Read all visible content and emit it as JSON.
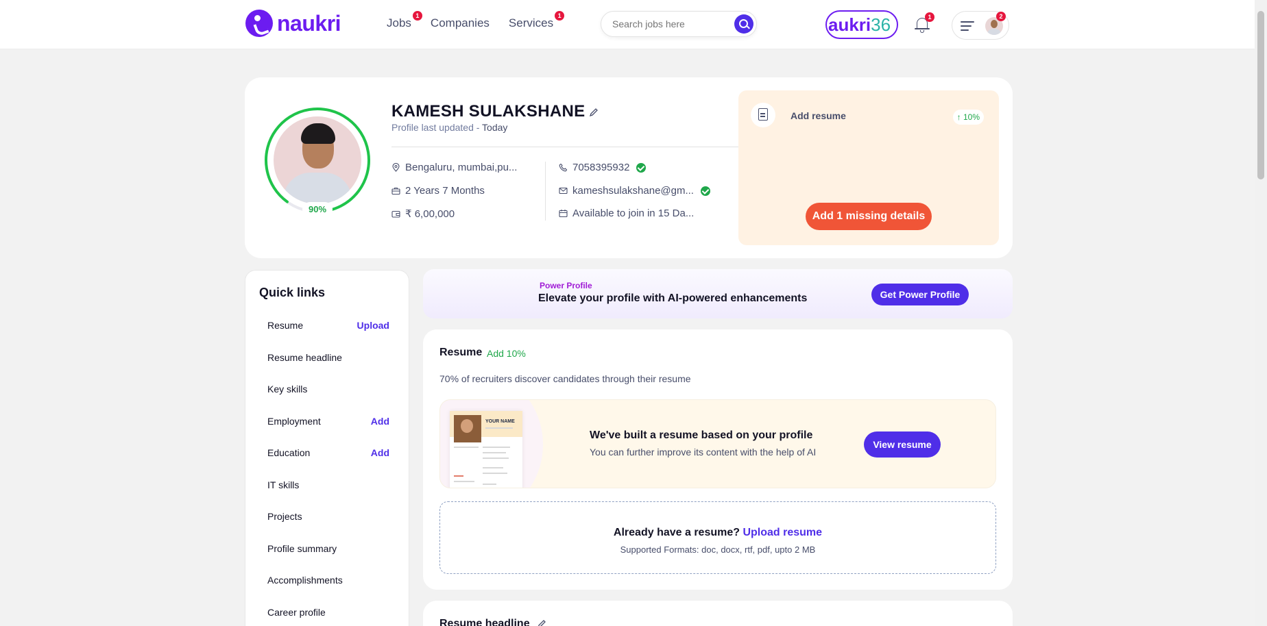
{
  "header": {
    "logo_text": "naukri",
    "nav": [
      {
        "label": "Jobs",
        "badge": "1"
      },
      {
        "label": "Companies",
        "badge": ""
      },
      {
        "label": "Services",
        "badge": "1"
      }
    ],
    "search_placeholder": "Search jobs here",
    "naukri360": {
      "left": "aukri",
      "right": "36"
    },
    "bell_badge": "1",
    "menu_badge": "2"
  },
  "profile": {
    "name": "KAMESH SULAKSHANE",
    "updated_label": "Profile last updated - ",
    "updated_value": "Today",
    "completion": "90%",
    "completion_value": 0.9,
    "location": "Bengaluru, mumbai,pu...",
    "experience": "2 Years 7 Months",
    "salary": "₹ 6,00,000",
    "phone": "7058395932",
    "email": "kameshsulakshane@gm...",
    "notice": "Available to join in 15 Da..."
  },
  "missing": {
    "item_label": "Add resume",
    "item_pct": "↑ 10%",
    "button": "Add 1 missing details"
  },
  "quick_links": {
    "title": "Quick links",
    "items": [
      {
        "label": "Resume",
        "action": "Upload"
      },
      {
        "label": "Resume headline",
        "action": ""
      },
      {
        "label": "Key skills",
        "action": ""
      },
      {
        "label": "Employment",
        "action": "Add"
      },
      {
        "label": "Education",
        "action": "Add"
      },
      {
        "label": "IT skills",
        "action": ""
      },
      {
        "label": "Projects",
        "action": ""
      },
      {
        "label": "Profile summary",
        "action": ""
      },
      {
        "label": "Accomplishments",
        "action": ""
      },
      {
        "label": "Career profile",
        "action": ""
      }
    ]
  },
  "power_profile": {
    "tag": "Power Profile",
    "headline": "Elevate your profile with AI-powered enhancements",
    "button": "Get Power Profile"
  },
  "resume": {
    "title": "Resume",
    "add_pct": "Add 10%",
    "subtitle": "70% of recruiters discover candidates through their resume",
    "built_headline": "We've built a resume based on your profile",
    "built_sub": "You can further improve its content with the help of AI",
    "view_button": "View resume",
    "preview_name": "YOUR NAME",
    "upload_question": "Already have a resume?",
    "upload_link": "Upload resume",
    "formats": "Supported Formats: doc, docx, rtf, pdf, upto 2 MB"
  },
  "next_section": {
    "title": "Resume headline"
  }
}
